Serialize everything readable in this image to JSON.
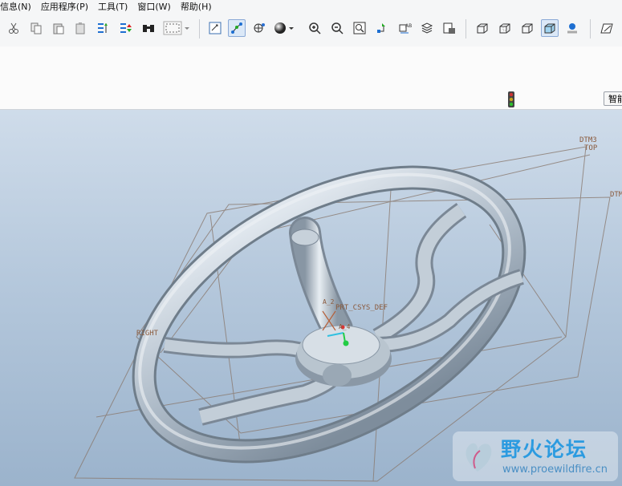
{
  "menu": [
    "信息(N)",
    "应用程序(P)",
    "工具(T)",
    "窗口(W)",
    "帮助(H)"
  ],
  "toolbar_icons": [
    "cut-icon",
    "copy-icon",
    "paste-icon",
    "paste-special-icon",
    "regenerate-icon",
    "regen-manager-icon",
    "find-icon",
    "select-box-icon",
    "view-refit-icon",
    "datum-display-icon",
    "spin-center-icon",
    "shading-icon",
    "zoom-in-icon",
    "zoom-out-icon",
    "refit-icon",
    "reorient-icon",
    "saved-views-icon",
    "layers-icon",
    "appearance-icon",
    "wireframe-icon",
    "hidden-line-icon",
    "no-hidden-icon",
    "shaded-icon",
    "enhanced-realism-icon",
    "sketch-icon"
  ],
  "status": {
    "smart_label": "智能"
  },
  "model_labels": {
    "dtm3": "DTM3",
    "top": "TOP",
    "dtm_right": "DTM",
    "right": "RIGHT",
    "csys": "PRT_CSYS_DEF",
    "axis_a2": "A_2",
    "axis_a4": "A_4"
  },
  "watermark": {
    "title": "野火论坛",
    "url": "www.proewildfire.cn"
  },
  "colors": {
    "viewport_top": "#cfdcea",
    "viewport_bottom": "#9bb3cc",
    "datum": "#8a5a3c",
    "model": "#b9c4cf"
  }
}
